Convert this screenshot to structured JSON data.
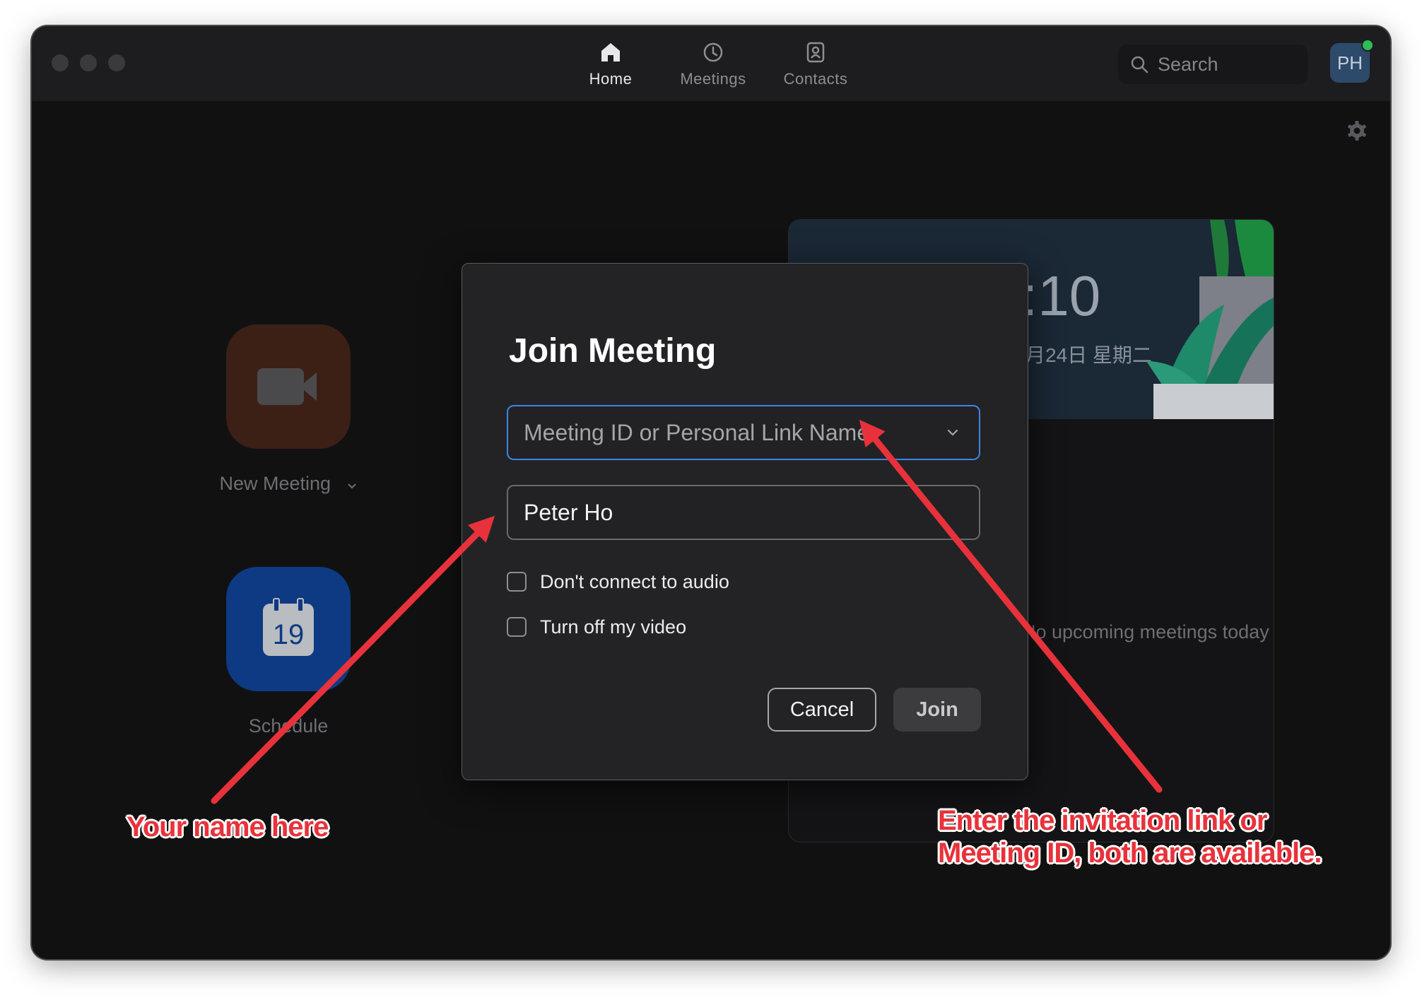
{
  "window": {
    "nav_tabs": [
      {
        "label": "Home",
        "icon": "home-icon",
        "active": true
      },
      {
        "label": "Meetings",
        "icon": "clock-icon",
        "active": false
      },
      {
        "label": "Contacts",
        "icon": "contacts-icon",
        "active": false
      }
    ],
    "search_label": "Search",
    "avatar_initials": "PH",
    "presence_color": "#2ebd59"
  },
  "home": {
    "new_meeting_label": "New Meeting",
    "schedule_label": "Schedule",
    "calendar_day": "19",
    "clock_text": ":10",
    "date_text": "月24日 星期二",
    "no_meetings_text": "No upcoming meetings today"
  },
  "dialog": {
    "title": "Join Meeting",
    "meeting_id_placeholder": "Meeting ID or Personal Link Name",
    "meeting_id_value": "",
    "name_value": "Peter Ho",
    "options": [
      {
        "label": "Don't connect to audio",
        "checked": false
      },
      {
        "label": "Turn off my video",
        "checked": false
      }
    ],
    "cancel_label": "Cancel",
    "join_label": "Join",
    "accent_color": "#3f83e4"
  },
  "annotations": {
    "name_note": "Your name here",
    "link_note_line1": "Enter the invitation link or",
    "link_note_line2": "Meeting ID, both are available.",
    "color": "#e8323b"
  }
}
